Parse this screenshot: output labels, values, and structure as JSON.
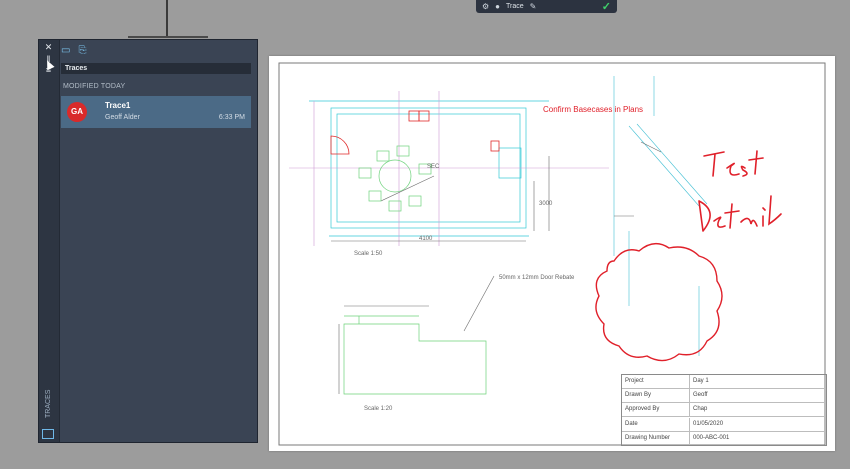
{
  "mini_toolbar": {
    "label": "Trace"
  },
  "palette": {
    "header": "Traces",
    "section": "MODIFIED TODAY",
    "strip_label": "TRACES",
    "trace": {
      "initials": "GA",
      "name": "Trace1",
      "owner": "Geoff Alder",
      "time": "6:33 PM"
    }
  },
  "drawing": {
    "markup_text": "Confirm Basecases in Plans",
    "handwriting_1": "Test",
    "handwriting_2": "Detail",
    "callout": "50mm x 12mm Door Rebate",
    "dim_a": "4100",
    "dim_b": "3000",
    "scale_1": "Scale 1:50",
    "scale_2": "Scale 1:20",
    "label_ref": "SEC"
  },
  "title_block": {
    "rows": [
      {
        "key": "Project",
        "value": "Day 1"
      },
      {
        "key": "Drawn By",
        "value": "Geoff"
      },
      {
        "key": "Approved By",
        "value": "Chap"
      },
      {
        "key": "Date",
        "value": "01/05/2020"
      },
      {
        "key": "Drawing Number",
        "value": "000-ABC-001"
      }
    ]
  }
}
